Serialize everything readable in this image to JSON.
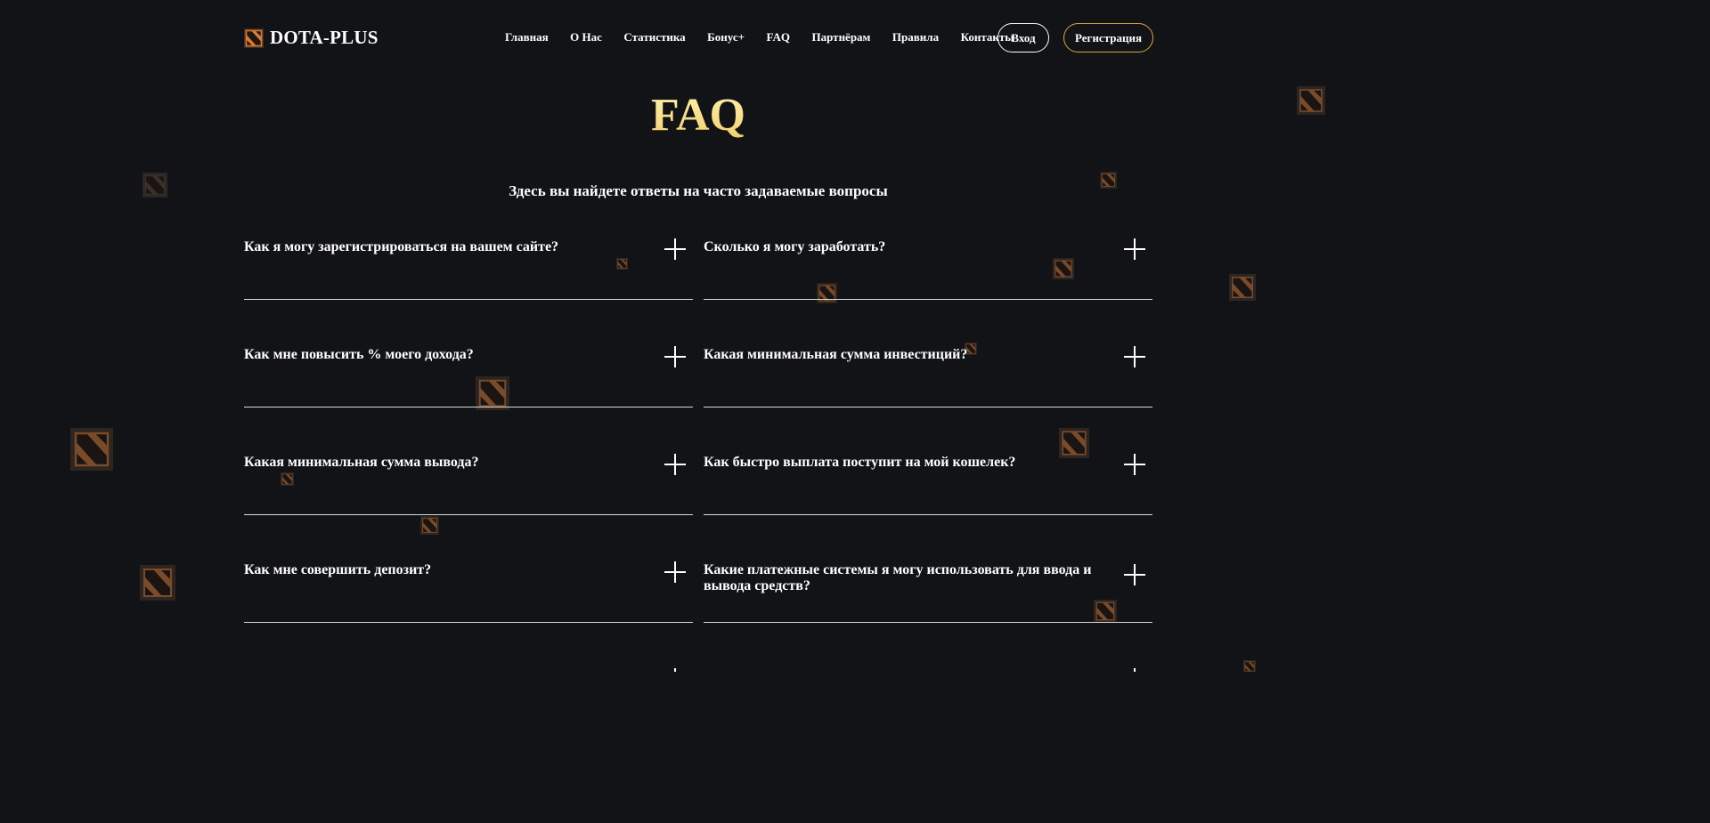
{
  "header": {
    "brand": "DOTA-PLUS",
    "nav": [
      {
        "label": "Главная"
      },
      {
        "label": "О Нас"
      },
      {
        "label": "Статистика"
      },
      {
        "label": "Бонус+"
      },
      {
        "label": "FAQ"
      },
      {
        "label": "Партнёрам"
      },
      {
        "label": "Правила"
      },
      {
        "label": "Контакты"
      }
    ],
    "login_label": "Вход",
    "register_label": "Регистрация"
  },
  "faq": {
    "title": "FAQ",
    "subtitle": "Здесь вы найдете ответы на часто задаваемые вопросы",
    "items": [
      {
        "question": "Как я могу зарегистрироваться на вашем сайте?"
      },
      {
        "question": "Сколько я могу заработать?"
      },
      {
        "question": "Как мне повысить % моего дохода?"
      },
      {
        "question": "Какая минимальная сумма инвестиций?"
      },
      {
        "question": "Какая минимальная сумма вывода?"
      },
      {
        "question": "Как быстро выплата поступит на мой кошелек?"
      },
      {
        "question": "Как мне совершить депозит?"
      },
      {
        "question": "Какие платежные системы я могу использовать для ввода и вывода средств?"
      }
    ]
  },
  "colors": {
    "background": "#121316",
    "accent_gold": "#f1cf6a",
    "register_border": "#d9a93a",
    "deco_orange": "#c0652b"
  },
  "icons": {
    "logo": "dota-logo-icon",
    "expand": "plus-icon",
    "decoration": "dota-logo-icon"
  }
}
